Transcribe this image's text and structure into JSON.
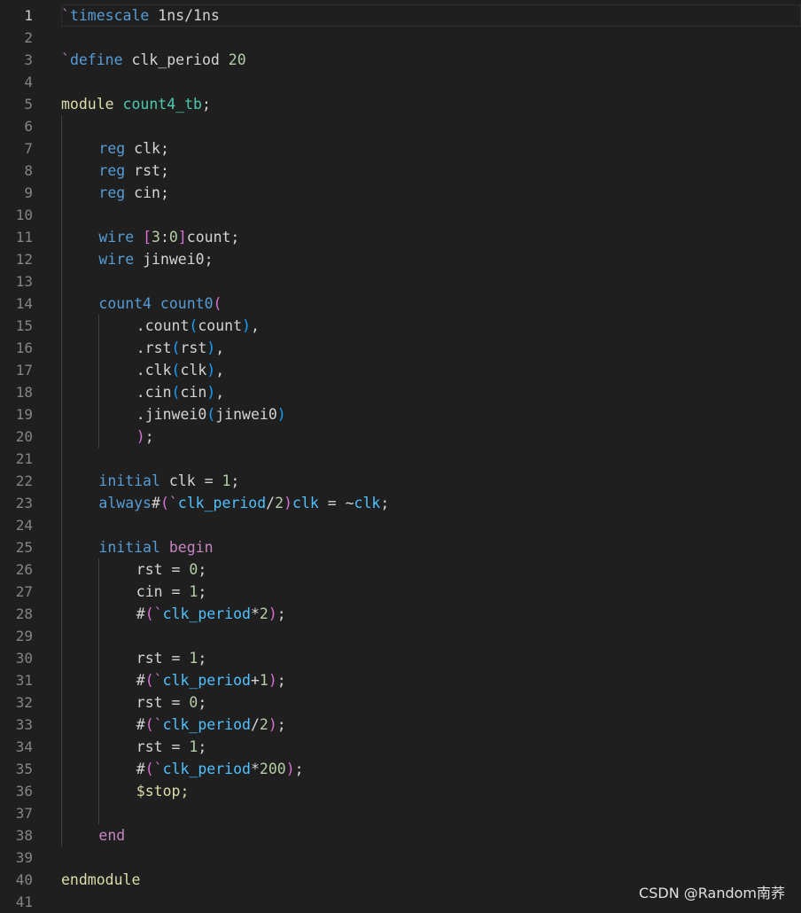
{
  "colors": {
    "background": "#1f1f1f",
    "line_number": "#858585",
    "line_number_active": "#cccccc",
    "text": "#d4d4d4",
    "keyword_blue": "#569cd6",
    "keyword_pink": "#c586c0",
    "type_teal": "#4ec9b0",
    "number_green": "#b5cea8",
    "yellow": "#dcdcaa",
    "macro_blue": "#4fc1ff",
    "bracket_gold": "#ffd700",
    "bracket_magenta": "#da70d6",
    "bracket_blue": "#179fff"
  },
  "editor": {
    "current_line": 1,
    "lines": [
      {
        "n": "1",
        "indent": 0,
        "guides": [],
        "tokens": [
          {
            "t": "`",
            "c": "#c586c0"
          },
          {
            "t": "timescale",
            "c": "#569cd6"
          },
          {
            "t": " 1ns/1ns",
            "c": "#d4d4d4"
          }
        ]
      },
      {
        "n": "2",
        "indent": 0,
        "guides": [],
        "tokens": []
      },
      {
        "n": "3",
        "indent": 0,
        "guides": [],
        "tokens": [
          {
            "t": "`",
            "c": "#c586c0"
          },
          {
            "t": "define",
            "c": "#569cd6"
          },
          {
            "t": " clk_period ",
            "c": "#d4d4d4"
          },
          {
            "t": "20",
            "c": "#b5cea8"
          }
        ]
      },
      {
        "n": "4",
        "indent": 0,
        "guides": [],
        "tokens": []
      },
      {
        "n": "5",
        "indent": 0,
        "guides": [],
        "tokens": [
          {
            "t": "module",
            "c": "#dcdcaa"
          },
          {
            "t": " ",
            "c": "#d4d4d4"
          },
          {
            "t": "count4_tb",
            "c": "#4ec9b0"
          },
          {
            "t": ";",
            "c": "#d4d4d4"
          }
        ]
      },
      {
        "n": "6",
        "indent": 0,
        "guides": [
          0
        ],
        "tokens": []
      },
      {
        "n": "7",
        "indent": 4,
        "guides": [
          0
        ],
        "tokens": [
          {
            "t": "reg",
            "c": "#569cd6"
          },
          {
            "t": " clk;",
            "c": "#d4d4d4"
          }
        ]
      },
      {
        "n": "8",
        "indent": 4,
        "guides": [
          0
        ],
        "tokens": [
          {
            "t": "reg",
            "c": "#569cd6"
          },
          {
            "t": " rst;",
            "c": "#d4d4d4"
          }
        ]
      },
      {
        "n": "9",
        "indent": 4,
        "guides": [
          0
        ],
        "tokens": [
          {
            "t": "reg",
            "c": "#569cd6"
          },
          {
            "t": " cin;",
            "c": "#d4d4d4"
          }
        ]
      },
      {
        "n": "10",
        "indent": 0,
        "guides": [
          0
        ],
        "tokens": []
      },
      {
        "n": "11",
        "indent": 4,
        "guides": [
          0
        ],
        "tokens": [
          {
            "t": "wire",
            "c": "#569cd6"
          },
          {
            "t": " ",
            "c": "#d4d4d4"
          },
          {
            "t": "[",
            "c": "#da70d6"
          },
          {
            "t": "3",
            "c": "#b5cea8"
          },
          {
            "t": ":",
            "c": "#d4d4d4"
          },
          {
            "t": "0",
            "c": "#b5cea8"
          },
          {
            "t": "]",
            "c": "#da70d6"
          },
          {
            "t": "count;",
            "c": "#d4d4d4"
          }
        ]
      },
      {
        "n": "12",
        "indent": 4,
        "guides": [
          0
        ],
        "tokens": [
          {
            "t": "wire",
            "c": "#569cd6"
          },
          {
            "t": " jinwei0;",
            "c": "#d4d4d4"
          }
        ]
      },
      {
        "n": "13",
        "indent": 0,
        "guides": [
          0
        ],
        "tokens": []
      },
      {
        "n": "14",
        "indent": 4,
        "guides": [
          0
        ],
        "tokens": [
          {
            "t": "count4 count0",
            "c": "#569cd6"
          },
          {
            "t": "(",
            "c": "#da70d6"
          }
        ]
      },
      {
        "n": "15",
        "indent": 8,
        "guides": [
          0,
          4
        ],
        "tokens": [
          {
            "t": ".count",
            "c": "#d4d4d4"
          },
          {
            "t": "(",
            "c": "#179fff"
          },
          {
            "t": "count",
            "c": "#d4d4d4"
          },
          {
            "t": ")",
            "c": "#179fff"
          },
          {
            "t": ",",
            "c": "#d4d4d4"
          }
        ]
      },
      {
        "n": "16",
        "indent": 8,
        "guides": [
          0,
          4
        ],
        "tokens": [
          {
            "t": ".rst",
            "c": "#d4d4d4"
          },
          {
            "t": "(",
            "c": "#179fff"
          },
          {
            "t": "rst",
            "c": "#d4d4d4"
          },
          {
            "t": ")",
            "c": "#179fff"
          },
          {
            "t": ",",
            "c": "#d4d4d4"
          }
        ]
      },
      {
        "n": "17",
        "indent": 8,
        "guides": [
          0,
          4
        ],
        "tokens": [
          {
            "t": ".clk",
            "c": "#d4d4d4"
          },
          {
            "t": "(",
            "c": "#179fff"
          },
          {
            "t": "clk",
            "c": "#d4d4d4"
          },
          {
            "t": ")",
            "c": "#179fff"
          },
          {
            "t": ",",
            "c": "#d4d4d4"
          }
        ]
      },
      {
        "n": "18",
        "indent": 8,
        "guides": [
          0,
          4
        ],
        "tokens": [
          {
            "t": ".cin",
            "c": "#d4d4d4"
          },
          {
            "t": "(",
            "c": "#179fff"
          },
          {
            "t": "cin",
            "c": "#d4d4d4"
          },
          {
            "t": ")",
            "c": "#179fff"
          },
          {
            "t": ",",
            "c": "#d4d4d4"
          }
        ]
      },
      {
        "n": "19",
        "indent": 8,
        "guides": [
          0,
          4
        ],
        "tokens": [
          {
            "t": ".jinwei0",
            "c": "#d4d4d4"
          },
          {
            "t": "(",
            "c": "#179fff"
          },
          {
            "t": "jinwei0",
            "c": "#d4d4d4"
          },
          {
            "t": ")",
            "c": "#179fff"
          }
        ]
      },
      {
        "n": "20",
        "indent": 8,
        "guides": [
          0,
          4
        ],
        "tokens": [
          {
            "t": ")",
            "c": "#da70d6"
          },
          {
            "t": ";",
            "c": "#d4d4d4"
          }
        ]
      },
      {
        "n": "21",
        "indent": 0,
        "guides": [
          0
        ],
        "tokens": []
      },
      {
        "n": "22",
        "indent": 4,
        "guides": [
          0
        ],
        "tokens": [
          {
            "t": "initial",
            "c": "#569cd6"
          },
          {
            "t": " clk = ",
            "c": "#d4d4d4"
          },
          {
            "t": "1",
            "c": "#b5cea8"
          },
          {
            "t": ";",
            "c": "#d4d4d4"
          }
        ]
      },
      {
        "n": "23",
        "indent": 4,
        "guides": [
          0
        ],
        "tokens": [
          {
            "t": "always",
            "c": "#569cd6"
          },
          {
            "t": "#",
            "c": "#d4d4d4"
          },
          {
            "t": "(",
            "c": "#da70d6"
          },
          {
            "t": "`",
            "c": "#c586c0"
          },
          {
            "t": "clk_period",
            "c": "#4fc1ff"
          },
          {
            "t": "/",
            "c": "#d4d4d4"
          },
          {
            "t": "2",
            "c": "#b5cea8"
          },
          {
            "t": ")",
            "c": "#da70d6"
          },
          {
            "t": "clk",
            "c": "#4fc1ff"
          },
          {
            "t": " = ~",
            "c": "#d4d4d4"
          },
          {
            "t": "clk",
            "c": "#4fc1ff"
          },
          {
            "t": ";",
            "c": "#d4d4d4"
          }
        ]
      },
      {
        "n": "24",
        "indent": 0,
        "guides": [
          0
        ],
        "tokens": []
      },
      {
        "n": "25",
        "indent": 4,
        "guides": [
          0
        ],
        "tokens": [
          {
            "t": "initial",
            "c": "#569cd6"
          },
          {
            "t": " ",
            "c": "#d4d4d4"
          },
          {
            "t": "begin",
            "c": "#c586c0"
          }
        ]
      },
      {
        "n": "26",
        "indent": 8,
        "guides": [
          0,
          4
        ],
        "tokens": [
          {
            "t": "rst = ",
            "c": "#d4d4d4"
          },
          {
            "t": "0",
            "c": "#b5cea8"
          },
          {
            "t": ";",
            "c": "#d4d4d4"
          }
        ]
      },
      {
        "n": "27",
        "indent": 8,
        "guides": [
          0,
          4
        ],
        "tokens": [
          {
            "t": "cin = ",
            "c": "#d4d4d4"
          },
          {
            "t": "1",
            "c": "#b5cea8"
          },
          {
            "t": ";",
            "c": "#d4d4d4"
          }
        ]
      },
      {
        "n": "28",
        "indent": 8,
        "guides": [
          0,
          4
        ],
        "tokens": [
          {
            "t": "#",
            "c": "#d4d4d4"
          },
          {
            "t": "(",
            "c": "#da70d6"
          },
          {
            "t": "`",
            "c": "#c586c0"
          },
          {
            "t": "clk_period",
            "c": "#4fc1ff"
          },
          {
            "t": "*",
            "c": "#d4d4d4"
          },
          {
            "t": "2",
            "c": "#b5cea8"
          },
          {
            "t": ")",
            "c": "#da70d6"
          },
          {
            "t": ";",
            "c": "#d4d4d4"
          }
        ]
      },
      {
        "n": "29",
        "indent": 0,
        "guides": [
          0,
          4
        ],
        "tokens": []
      },
      {
        "n": "30",
        "indent": 8,
        "guides": [
          0,
          4
        ],
        "tokens": [
          {
            "t": "rst = ",
            "c": "#d4d4d4"
          },
          {
            "t": "1",
            "c": "#b5cea8"
          },
          {
            "t": ";",
            "c": "#d4d4d4"
          }
        ]
      },
      {
        "n": "31",
        "indent": 8,
        "guides": [
          0,
          4
        ],
        "tokens": [
          {
            "t": "#",
            "c": "#d4d4d4"
          },
          {
            "t": "(",
            "c": "#da70d6"
          },
          {
            "t": "`",
            "c": "#c586c0"
          },
          {
            "t": "clk_period",
            "c": "#4fc1ff"
          },
          {
            "t": "+",
            "c": "#d4d4d4"
          },
          {
            "t": "1",
            "c": "#b5cea8"
          },
          {
            "t": ")",
            "c": "#da70d6"
          },
          {
            "t": ";",
            "c": "#d4d4d4"
          }
        ]
      },
      {
        "n": "32",
        "indent": 8,
        "guides": [
          0,
          4
        ],
        "tokens": [
          {
            "t": "rst = ",
            "c": "#d4d4d4"
          },
          {
            "t": "0",
            "c": "#b5cea8"
          },
          {
            "t": ";",
            "c": "#d4d4d4"
          }
        ]
      },
      {
        "n": "33",
        "indent": 8,
        "guides": [
          0,
          4
        ],
        "tokens": [
          {
            "t": "#",
            "c": "#d4d4d4"
          },
          {
            "t": "(",
            "c": "#da70d6"
          },
          {
            "t": "`",
            "c": "#c586c0"
          },
          {
            "t": "clk_period",
            "c": "#4fc1ff"
          },
          {
            "t": "/",
            "c": "#d4d4d4"
          },
          {
            "t": "2",
            "c": "#b5cea8"
          },
          {
            "t": ")",
            "c": "#da70d6"
          },
          {
            "t": ";",
            "c": "#d4d4d4"
          }
        ]
      },
      {
        "n": "34",
        "indent": 8,
        "guides": [
          0,
          4
        ],
        "tokens": [
          {
            "t": "rst = ",
            "c": "#d4d4d4"
          },
          {
            "t": "1",
            "c": "#b5cea8"
          },
          {
            "t": ";",
            "c": "#d4d4d4"
          }
        ]
      },
      {
        "n": "35",
        "indent": 8,
        "guides": [
          0,
          4
        ],
        "tokens": [
          {
            "t": "#",
            "c": "#d4d4d4"
          },
          {
            "t": "(",
            "c": "#da70d6"
          },
          {
            "t": "`",
            "c": "#c586c0"
          },
          {
            "t": "clk_period",
            "c": "#4fc1ff"
          },
          {
            "t": "*",
            "c": "#d4d4d4"
          },
          {
            "t": "200",
            "c": "#b5cea8"
          },
          {
            "t": ")",
            "c": "#da70d6"
          },
          {
            "t": ";",
            "c": "#d4d4d4"
          }
        ]
      },
      {
        "n": "36",
        "indent": 8,
        "guides": [
          0,
          4
        ],
        "tokens": [
          {
            "t": "$stop;",
            "c": "#dcdcaa"
          }
        ]
      },
      {
        "n": "37",
        "indent": 0,
        "guides": [
          0,
          4
        ],
        "tokens": []
      },
      {
        "n": "38",
        "indent": 4,
        "guides": [
          0
        ],
        "tokens": [
          {
            "t": "end",
            "c": "#c586c0"
          }
        ]
      },
      {
        "n": "39",
        "indent": 0,
        "guides": [],
        "tokens": []
      },
      {
        "n": "40",
        "indent": 0,
        "guides": [],
        "tokens": [
          {
            "t": "endmodule",
            "c": "#dcdcaa"
          }
        ]
      },
      {
        "n": "41",
        "indent": 0,
        "guides": [],
        "tokens": []
      }
    ]
  },
  "watermark": "CSDN @Random南荞"
}
